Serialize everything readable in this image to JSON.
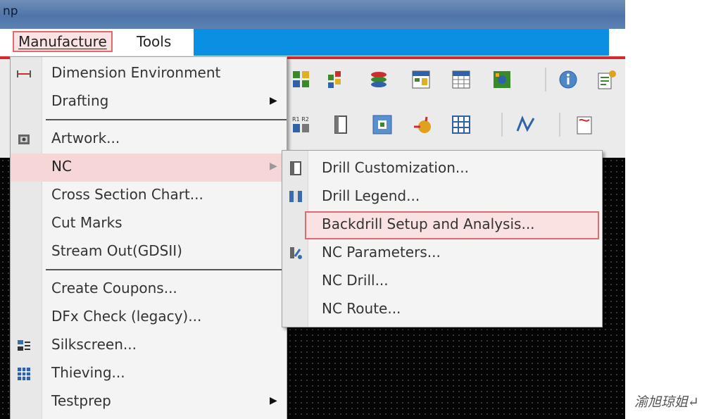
{
  "window": {
    "title_fragment": "np"
  },
  "menubar": {
    "items": [
      {
        "label": "Manufacture",
        "active": true
      },
      {
        "label": "Tools",
        "active": false
      }
    ]
  },
  "manufacture_menu": {
    "items": [
      {
        "label": "Dimension Environment",
        "icon": "dimension-icon"
      },
      {
        "label": "Drafting",
        "submenu": true
      },
      {
        "label": "Artwork...",
        "icon": "artwork-icon"
      },
      {
        "label": "NC",
        "submenu": true,
        "highlighted": true
      },
      {
        "label": "Cross Section Chart..."
      },
      {
        "label": "Cut Marks"
      },
      {
        "label": "Stream Out(GDSII)"
      },
      {
        "label": "Create Coupons..."
      },
      {
        "label": "DFx Check (legacy)..."
      },
      {
        "label": "Silkscreen...",
        "icon": "silkscreen-icon"
      },
      {
        "label": "Thieving...",
        "icon": "thieving-icon"
      },
      {
        "label": "Testprep",
        "submenu": true
      }
    ],
    "submenu_arrow": "▶"
  },
  "nc_submenu": {
    "items": [
      {
        "label": "Drill Customization...",
        "icon": "drill-customization-icon"
      },
      {
        "label": "Drill Legend...",
        "icon": "drill-legend-icon"
      },
      {
        "label": "Backdrill Setup and Analysis...",
        "highlighted": true
      },
      {
        "label": "NC Parameters...",
        "icon": "nc-parameters-icon"
      },
      {
        "label": "NC Drill..."
      },
      {
        "label": "NC Route..."
      }
    ]
  },
  "toolbar": {
    "row1": [
      "grid-layout-icon",
      "color-grid-icon",
      "layer-stack-icon",
      "scm-icon",
      "dfa-icon",
      "board-icon",
      "info-icon",
      "report-icon"
    ],
    "row2": [
      "r1r2-icon",
      "property-icon",
      "placement-grid-icon",
      "route-icon",
      "pin-grid-icon",
      "net-icon",
      "doc-icon"
    ],
    "colors": {
      "icon_green": "#3a8a2a",
      "icon_blue": "#2f62a8",
      "icon_red": "#c83030"
    }
  },
  "colors": {
    "title_bar": "#5277aa",
    "menubar_accent": "#0a8fe3",
    "active_border": "#e26a6a",
    "highlight_bg": "#fbe3e3",
    "canvas": "#050505"
  },
  "watermark": {
    "text": "渝旭琼姐↵"
  }
}
